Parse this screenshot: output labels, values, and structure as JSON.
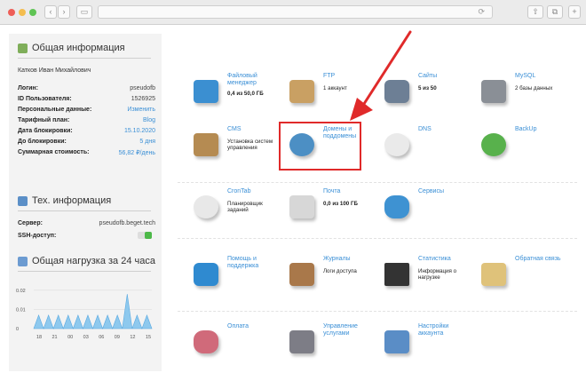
{
  "browser": {
    "back_glyph": "‹",
    "forward_glyph": "›",
    "sidebar_glyph": "▭",
    "reload_glyph": "⟳",
    "share_glyph": "⇧",
    "tabs_glyph": "⧉",
    "new_tab_glyph": "+"
  },
  "sidebar": {
    "general": {
      "title": "Общая информация",
      "icon": "user-icon",
      "user_name": "Катков Иван Михайлович",
      "rows": [
        {
          "label": "Логин:",
          "value": "pseudofb",
          "link": false
        },
        {
          "label": "ID Пользователя:",
          "value": "1526925",
          "link": false
        },
        {
          "label": "Персональные данные:",
          "value": "Изменить",
          "link": true
        },
        {
          "label": "Тарифный план:",
          "value": "Blog",
          "link": true
        },
        {
          "label": "Дата блокировки:",
          "value": "15.10.2020",
          "link": true
        },
        {
          "label": "До блокировки:",
          "value": "5 дня",
          "link": true
        },
        {
          "label": "Суммарная стоимость:",
          "value": "56,82 ₽/день",
          "link": true
        }
      ]
    },
    "tech": {
      "title": "Тех. информация",
      "icon": "server-icon",
      "server_label": "Сервер:",
      "server_value": "pseudofb.beget.tech",
      "ssh_label": "SSH-доступ:"
    },
    "load": {
      "title": "Общая нагрузка за 24 часа",
      "icon": "chart-icon"
    }
  },
  "chart_data": {
    "type": "area",
    "title": "Общая нагрузка за 24 часа",
    "x": [
      "18",
      "21",
      "00",
      "03",
      "06",
      "09",
      "12",
      "15"
    ],
    "y_ticks": [
      "0.02",
      "0.01",
      "0"
    ],
    "ylim": [
      0,
      0.025
    ],
    "values": [
      0,
      0.007,
      0,
      0.007,
      0,
      0.007,
      0,
      0.007,
      0,
      0.007,
      0,
      0.007,
      0,
      0.007,
      0,
      0.007,
      0,
      0.007,
      0,
      0.018,
      0,
      0.007,
      0,
      0.007,
      0
    ],
    "color": "#8ec9ee"
  },
  "tiles": [
    {
      "id": "files",
      "title": "Файловый менеджер",
      "sub": "0,4 из 50,0 ГБ",
      "sub_bold": true,
      "icon": "file-manager-icon"
    },
    {
      "id": "ftp",
      "title": "FTP",
      "sub": "1 аккаунт",
      "sub_bold": false,
      "icon": "ftp-icon"
    },
    {
      "id": "sites",
      "title": "Сайты",
      "sub": "5 из 50",
      "sub_bold": true,
      "icon": "sites-icon"
    },
    {
      "id": "mysql",
      "title": "MySQL",
      "sub": "2 базы данных",
      "sub_bold": false,
      "icon": "mysql-icon"
    },
    {
      "id": "cms",
      "title": "CMS",
      "sub": "Установка систем управления",
      "sub_bold": false,
      "icon": "cms-icon"
    },
    {
      "id": "domains",
      "title": "Домены и поддомены",
      "sub": "",
      "sub_bold": false,
      "icon": "domains-icon"
    },
    {
      "id": "dns",
      "title": "DNS",
      "sub": "",
      "sub_bold": false,
      "icon": "dns-icon"
    },
    {
      "id": "backup",
      "title": "BackUp",
      "sub": "",
      "sub_bold": false,
      "icon": "backup-icon"
    },
    {
      "id": "crontab",
      "title": "CronTab",
      "sub": "Планировщик заданий",
      "sub_bold": false,
      "icon": "clock-icon"
    },
    {
      "id": "mail",
      "title": "Почта",
      "sub": "0,0 из 100 ГБ",
      "sub_bold": true,
      "icon": "mail-icon"
    },
    {
      "id": "services",
      "title": "Сервисы",
      "sub": "",
      "sub_bold": false,
      "icon": "services-icon"
    },
    {
      "id": "help",
      "title": "Помощь и поддержка",
      "sub": "",
      "sub_bold": false,
      "icon": "help-icon"
    },
    {
      "id": "logs",
      "title": "Журналы",
      "sub": "Логи доступа",
      "sub_bold": false,
      "icon": "logs-icon"
    },
    {
      "id": "stats",
      "title": "Статистика",
      "sub": "Информация о нагрузке",
      "sub_bold": false,
      "icon": "stats-icon"
    },
    {
      "id": "feedback",
      "title": "Обратная связь",
      "sub": "",
      "sub_bold": false,
      "icon": "feedback-icon"
    },
    {
      "id": "payment",
      "title": "Оплата",
      "sub": "",
      "sub_bold": false,
      "icon": "payment-icon"
    },
    {
      "id": "manage",
      "title": "Управление услугами",
      "sub": "",
      "sub_bold": false,
      "icon": "manage-icon"
    },
    {
      "id": "account",
      "title": "Настройки аккаунта",
      "sub": "",
      "sub_bold": false,
      "icon": "account-icon"
    }
  ],
  "colors": {
    "accent": "#3a8fd6",
    "highlight": "#e02a2a"
  }
}
